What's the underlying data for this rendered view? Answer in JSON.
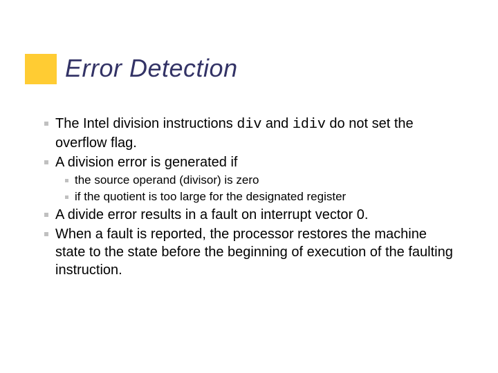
{
  "title": "Error Detection",
  "body": {
    "p1_a": "The Intel division instructions ",
    "code1": "div",
    "p1_b": " and ",
    "code2": "idiv",
    "p1_c": " do not set the overflow flag.",
    "p2": "A division error is generated if",
    "sub1": "the source operand (divisor) is zero",
    "sub2": "if the quotient is too large for the designated register",
    "p3": "A divide error results in a fault on interrupt vector 0.",
    "p4": "When a fault is reported, the processor restores the machine state to the state before the beginning of execution of the faulting instruction."
  }
}
